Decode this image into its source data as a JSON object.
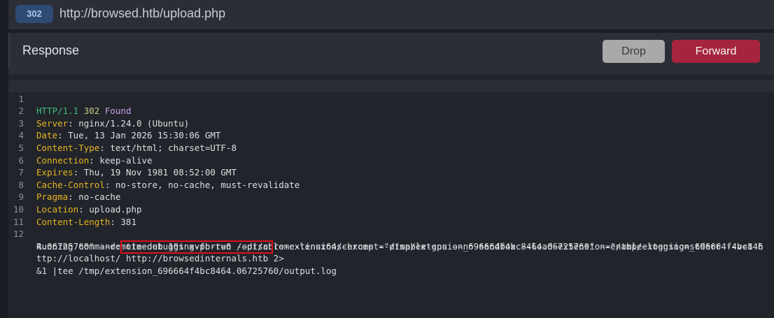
{
  "request": {
    "status_code": "302",
    "url": "http://browsed.htb/upload.php"
  },
  "response_panel": {
    "title": "Response",
    "drop_label": "Drop",
    "forward_label": "Forward"
  },
  "response_lines": [
    {
      "n": "1",
      "proto": "HTTP/1.1",
      "code": "302",
      "reason": "Found"
    },
    {
      "n": "2",
      "key": "Server",
      "value": ": nginx/1.24.0 (Ubuntu)"
    },
    {
      "n": "3",
      "key": "Date",
      "value": ": Tue, 13 Jan 2026 15:30:06 GMT"
    },
    {
      "n": "4",
      "key": "Content-Type",
      "value": ": text/html; charset=UTF-8"
    },
    {
      "n": "5",
      "key": "Connection",
      "value": ": keep-alive"
    },
    {
      "n": "6",
      "key": "Expires",
      "value": ": Thu, 19 Nov 1981 08:52:00 GMT"
    },
    {
      "n": "7",
      "key": "Cache-Control",
      "value": ": no-store, no-cache, must-revalidate"
    },
    {
      "n": "8",
      "key": "Pragma",
      "value": ": no-cache"
    },
    {
      "n": "9",
      "key": "Location",
      "value": ": upload.php"
    },
    {
      "n": "10",
      "key": "Content-Length",
      "value": ": 381"
    },
    {
      "n": "11"
    },
    {
      "n": "12",
      "body_1": "Running command: timeout 10s xvfb-run /opt/chrome-linux64/chrome --disable-gpu --no-sandbox --load-extension=\"/tmp/extension_696664f4bc846",
      "body_2": "4.06725760\" --remote-debugging-port=0 --disable-extensions-except=\"/tmp/extension_696664f4bc8464.06725760\" --enable-logging=stderr --v=1 h",
      "body_3_pre": "ttp://localhost/ ",
      "body_3_highlight": "http://browsedinternals.htb",
      "body_3_post": " 2>",
      "body_4": "&1 |tee /tmp/extension_696664f4bc8464.06725760/output.log"
    }
  ]
}
